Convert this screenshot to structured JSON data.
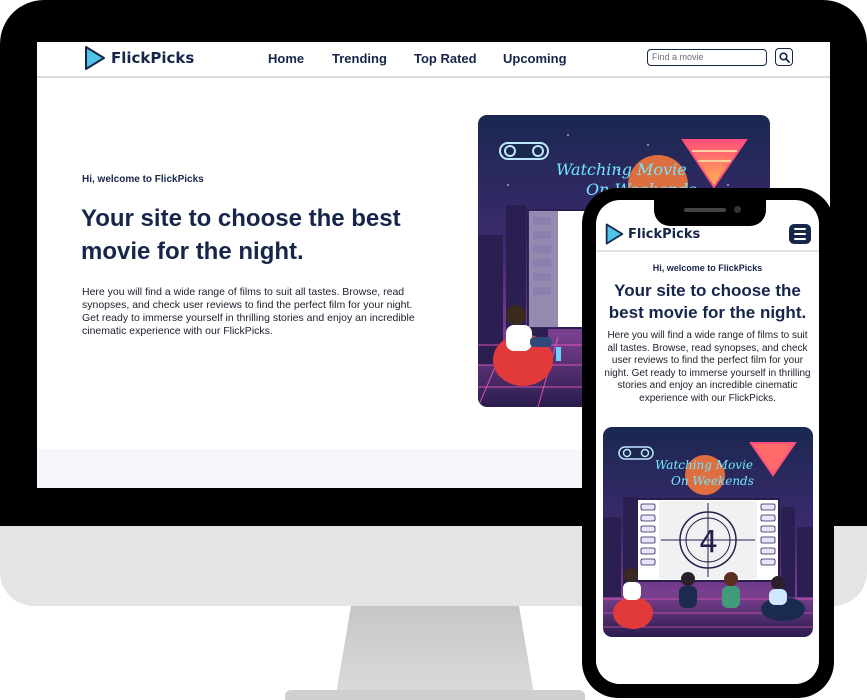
{
  "brand": {
    "name": "FlickPicks",
    "navy": "#16254a",
    "accent_cyan": "#4fc3e8"
  },
  "desktop": {
    "nav": {
      "links": [
        "Home",
        "Trending",
        "Top Rated",
        "Upcoming"
      ],
      "search_placeholder": "Find a movie",
      "search_icon": "search-icon"
    },
    "hero": {
      "greeting": "Hi, welcome to FlickPicks",
      "title": "Your site to choose the best movie for the night.",
      "description": "Here you will find a wide range of films to suit all tastes. Browse, read synopses, and check user reviews to find the perfect film for your night. Get ready to immerse yourself in thrilling stories and enjoy an incredible cinematic experience with our FlickPicks."
    },
    "illustration": {
      "neon_text_line1": "Watching Movie",
      "neon_text_line2": "On Weekends",
      "countdown": "4"
    }
  },
  "mobile": {
    "nav": {
      "menu_icon": "hamburger-menu-icon"
    },
    "hero": {
      "greeting": "Hi, welcome to FlickPicks",
      "title": "Your site to choose the best movie for the night.",
      "description": "Here you will find a wide range of films to suit all tastes. Browse, read synopses, and check user reviews to find the perfect film for your night. Get ready to immerse yourself in thrilling stories and enjoy an incredible cinematic experience with our FlickPicks."
    }
  }
}
